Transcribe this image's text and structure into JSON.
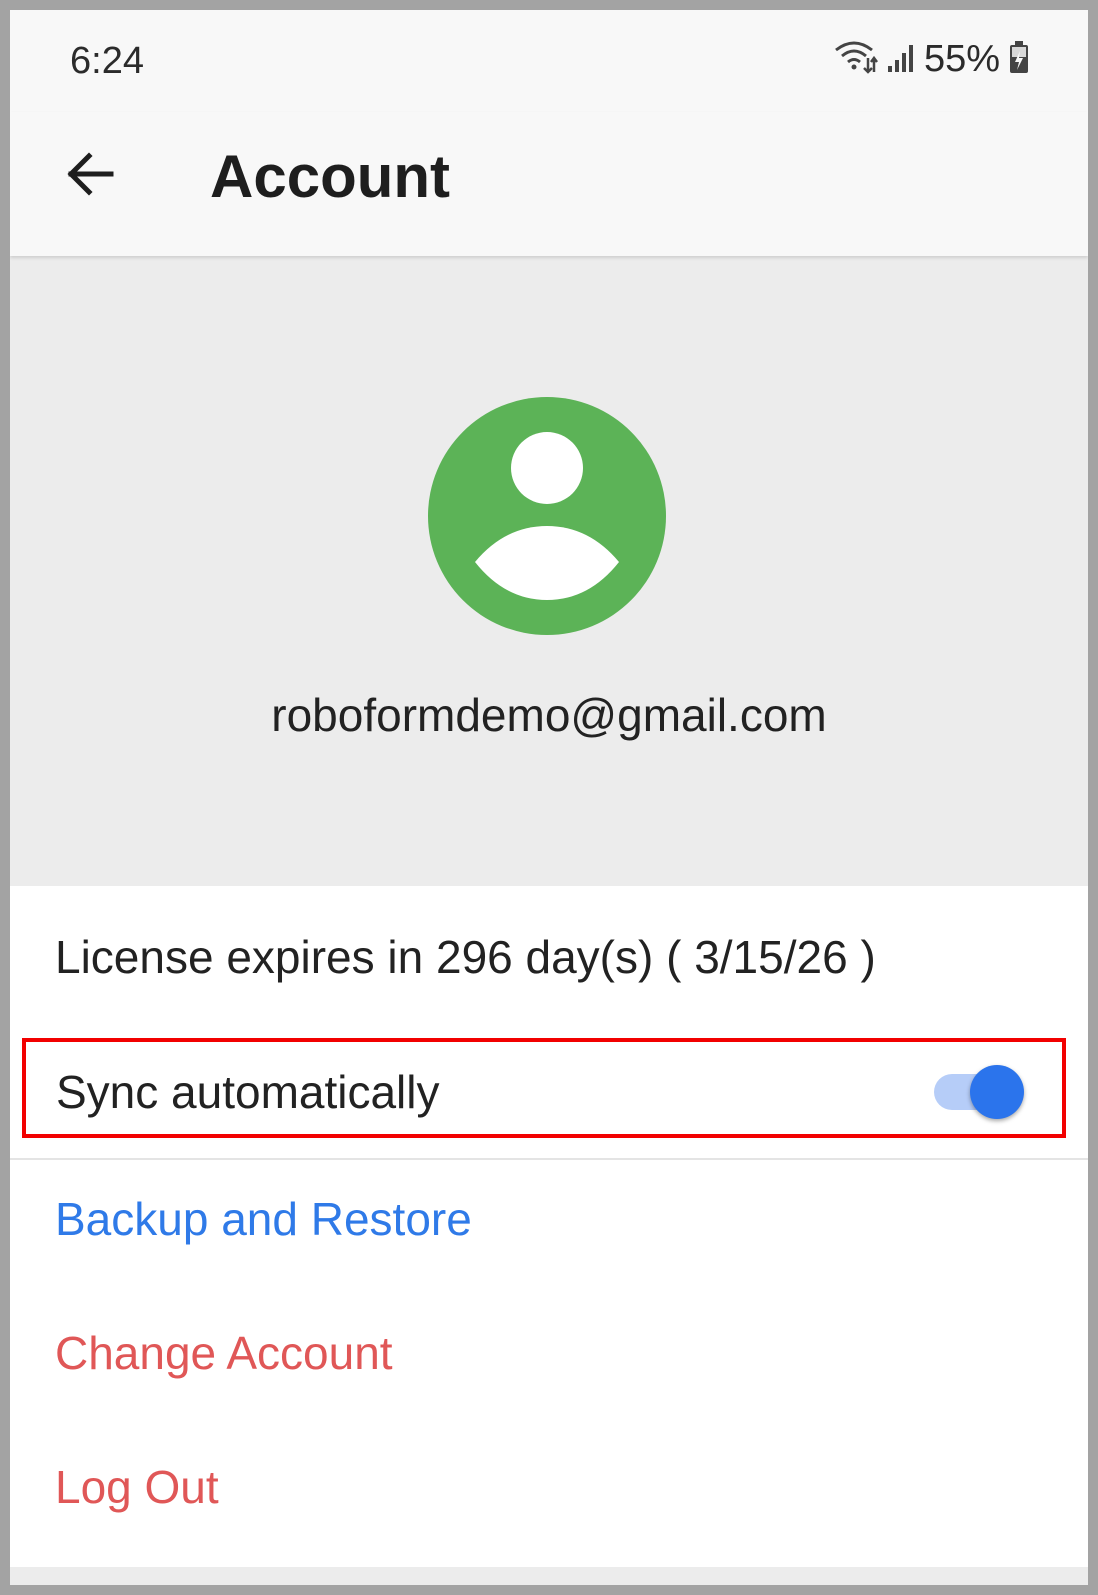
{
  "status_bar": {
    "time": "6:24",
    "battery": "55%",
    "icons": [
      "wifi-icon",
      "signal-icon",
      "battery-charging-icon"
    ]
  },
  "app_bar": {
    "back_icon": "arrow-left-icon",
    "title": "Account"
  },
  "profile": {
    "avatar_icon": "account-circle-icon",
    "avatar_color": "#5cb357",
    "email": "roboformdemo@gmail.com"
  },
  "settings": {
    "license_text": "License expires in 296 day(s) ( 3/15/26 )",
    "sync": {
      "label": "Sync automatically",
      "enabled": true
    },
    "links": {
      "backup": "Backup and Restore",
      "change_account": "Change Account",
      "logout": "Log Out"
    }
  },
  "colors": {
    "accent_blue": "#2f7ae8",
    "danger_red": "#e05757",
    "highlight_border": "#f20000"
  }
}
